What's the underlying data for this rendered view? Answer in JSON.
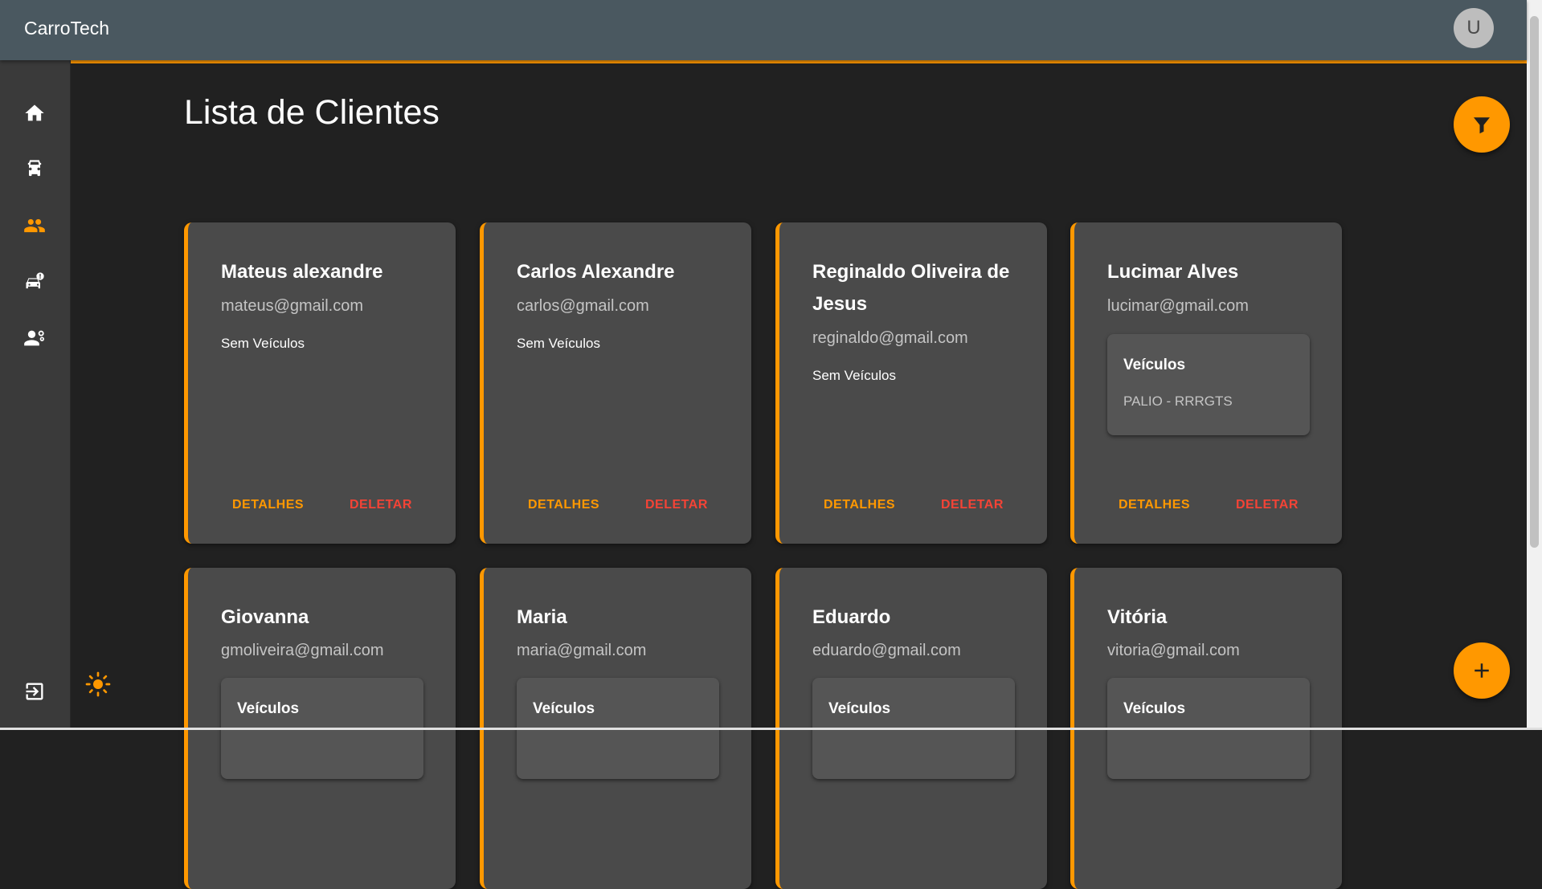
{
  "app": {
    "title": "CarroTech",
    "user_initial": "U"
  },
  "colors": {
    "accent": "#ff9800",
    "danger": "#f44336",
    "topbar": "#4a5860",
    "background": "#212121",
    "card": "#4a4a4a"
  },
  "sidebar": {
    "items": [
      {
        "icon": "home-icon",
        "active": false
      },
      {
        "icon": "car-icon",
        "active": false
      },
      {
        "icon": "people-icon",
        "active": true
      },
      {
        "icon": "car-alert-icon",
        "active": false
      },
      {
        "icon": "engineer-icon",
        "active": false
      }
    ],
    "bottom_icon": "logout-icon"
  },
  "page": {
    "title": "Lista de Clientes"
  },
  "filter_icon": "filter-icon",
  "add_icon": "add-icon",
  "theme_icon": "sun-icon",
  "clients": [
    {
      "name": "Mateus alexandre",
      "email": "mateus@gmail.com",
      "no_vehicles": "Sem Veículos",
      "details": "DETALHES",
      "delete": "DELETAR"
    },
    {
      "name": "Carlos Alexandre",
      "email": "carlos@gmail.com",
      "no_vehicles": "Sem Veículos",
      "details": "DETALHES",
      "delete": "DELETAR"
    },
    {
      "name": "Reginaldo Oliveira de Jesus",
      "email": "reginaldo@gmail.com",
      "no_vehicles": "Sem Veículos",
      "details": "DETALHES",
      "delete": "DELETAR"
    },
    {
      "name": "Lucimar Alves",
      "email": "lucimar@gmail.com",
      "vehicles_title": "Veículos",
      "vehicle": "PALIO - RRRGTS",
      "details": "DETALHES",
      "delete": "DELETAR"
    },
    {
      "name": "Giovanna",
      "email": "gmoliveira@gmail.com",
      "vehicles_title": "Veículos"
    },
    {
      "name": "Maria",
      "email": "maria@gmail.com",
      "vehicles_title": "Veículos"
    },
    {
      "name": "Eduardo",
      "email": "eduardo@gmail.com",
      "vehicles_title": "Veículos"
    },
    {
      "name": "Vitória",
      "email": "vitoria@gmail.com",
      "vehicles_title": "Veículos"
    }
  ]
}
